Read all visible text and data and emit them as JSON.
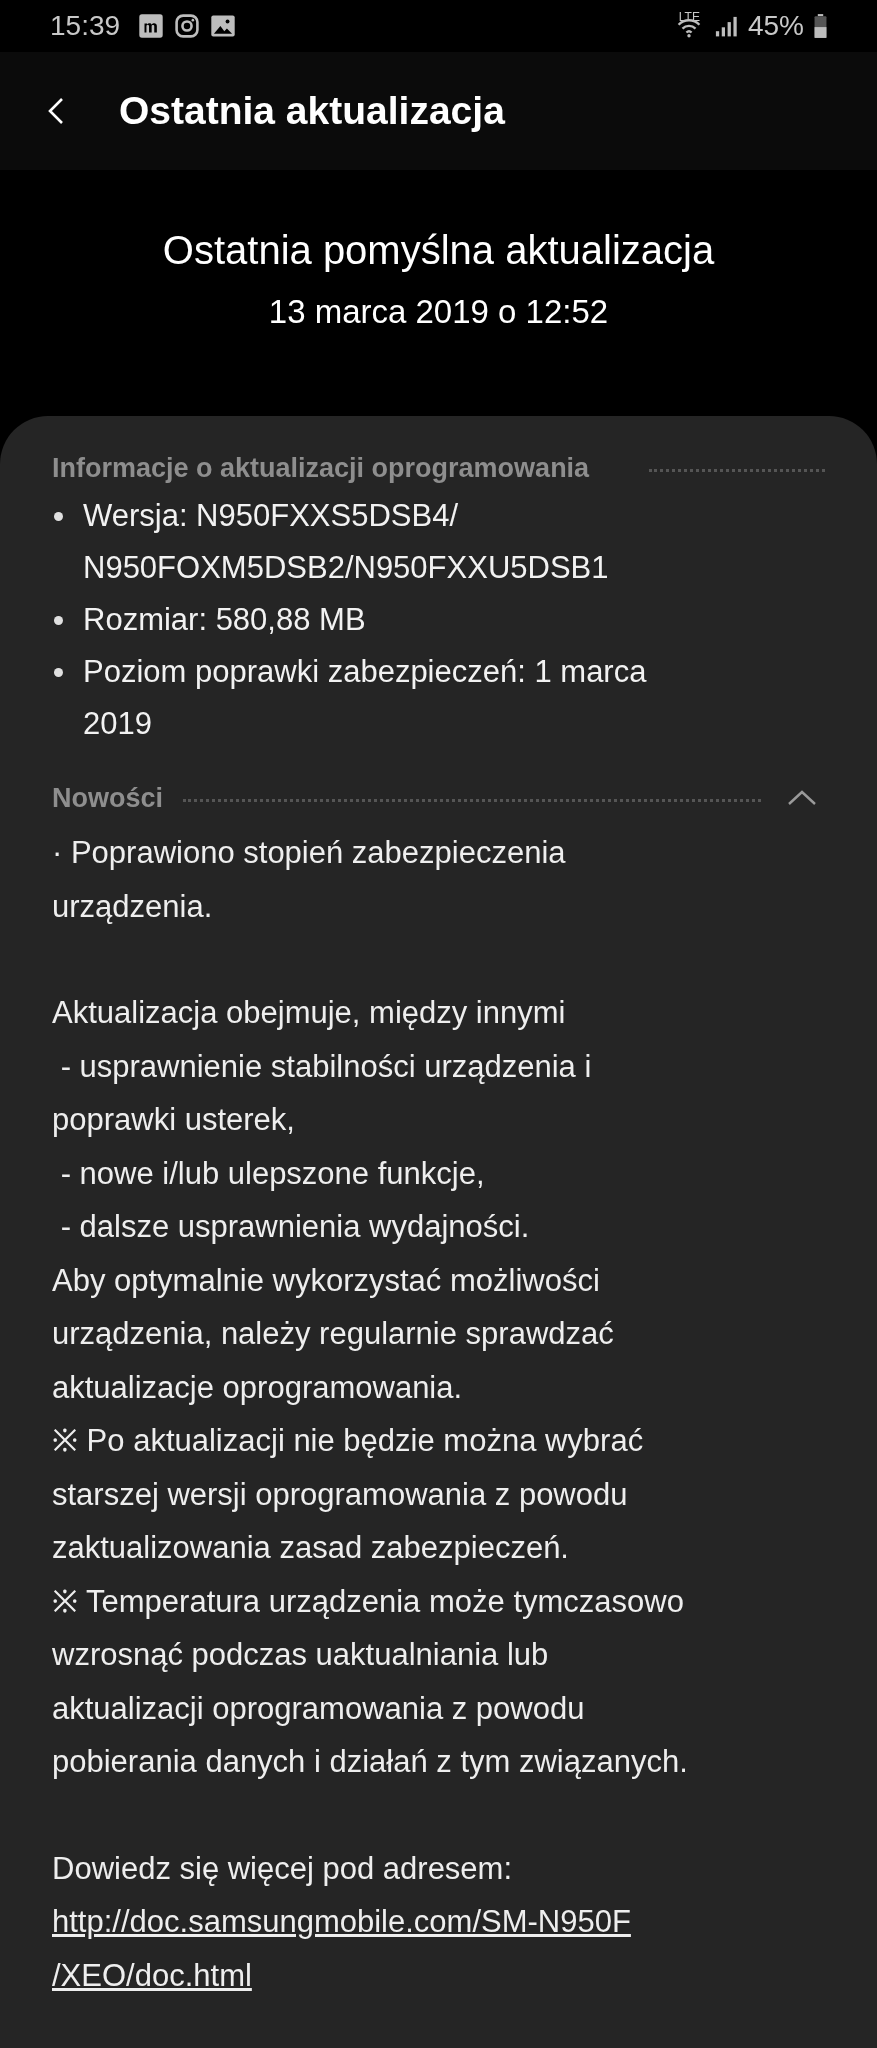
{
  "status_bar": {
    "time": "15:39",
    "network": "LTE",
    "battery": "45%"
  },
  "app_bar": {
    "title": "Ostatnia aktualizacja"
  },
  "summary": {
    "title": "Ostatnia pomyślna aktualizacja",
    "date": "13 marca 2019 o 12:52"
  },
  "info": {
    "heading": "Informacje o aktualizacji oprogramowania",
    "items": [
      "Wersja: N950FXXS5DSB4/\nN950FOXM5DSB2/N950FXXU5DSB1",
      "Rozmiar: 580,88 MB",
      "Poziom poprawki zabezpieczeń: 1 marca\n2019"
    ]
  },
  "news": {
    "heading": "Nowości",
    "expanded": true,
    "paragraphs": [
      {
        "kind": "text",
        "text": "· Poprawiono stopień zabezpieczenia\nurządzenia."
      },
      {
        "kind": "gap"
      },
      {
        "kind": "text",
        "text": "Aktualizacja obejmuje, między innymi"
      },
      {
        "kind": "text",
        "text": " - usprawnienie stabilności urządzenia i\npoprawki usterek,"
      },
      {
        "kind": "text",
        "text": " - nowe i/lub ulepszone funkcje,"
      },
      {
        "kind": "text",
        "text": " - dalsze usprawnienia wydajności."
      },
      {
        "kind": "text",
        "text": "Aby optymalnie wykorzystać możliwości\nurządzenia, należy regularnie sprawdzać\naktualizacje oprogramowania."
      },
      {
        "kind": "text",
        "text": "※ Po aktualizacji nie będzie można wybrać\nstarszej wersji oprogramowania z powodu\nzaktualizowania zasad zabezpieczeń."
      },
      {
        "kind": "text",
        "text": "※ Temperatura urządzenia może tymczasowo\nwzrosnąć podczas uaktualniania lub\naktualizacji oprogramowania z powodu\npobierania danych i działań z tym związanych."
      },
      {
        "kind": "gap"
      },
      {
        "kind": "text",
        "text": "Dowiedz się więcej pod adresem:"
      },
      {
        "kind": "link",
        "text": "http://doc.samsungmobile.com/SM-N950F\n/XEO/doc.html"
      }
    ]
  }
}
